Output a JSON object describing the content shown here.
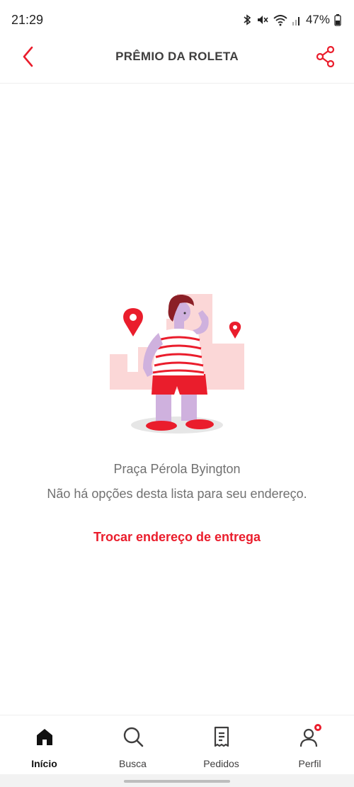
{
  "status_bar": {
    "time": "21:29",
    "battery": "47%",
    "icons": [
      "bluetooth-icon",
      "mute-icon",
      "wifi-icon",
      "signal-icon",
      "battery-icon"
    ]
  },
  "header": {
    "title": "PRÊMIO DA ROLETA",
    "back_icon": "chevron-left-icon",
    "share_icon": "share-icon",
    "accent_color": "#ea1d2c"
  },
  "empty_state": {
    "illustration": "woman-with-location-pins",
    "address": "Praça Pérola Byington",
    "message": "Não há opções desta lista para seu endereço.",
    "action_label": "Trocar endereço de entrega"
  },
  "bottom_nav": {
    "items": [
      {
        "label": "Início",
        "icon": "home-icon",
        "active": true
      },
      {
        "label": "Busca",
        "icon": "search-icon",
        "active": false
      },
      {
        "label": "Pedidos",
        "icon": "receipt-icon",
        "active": false
      },
      {
        "label": "Perfil",
        "icon": "profile-icon",
        "active": false,
        "badge": true
      }
    ]
  }
}
